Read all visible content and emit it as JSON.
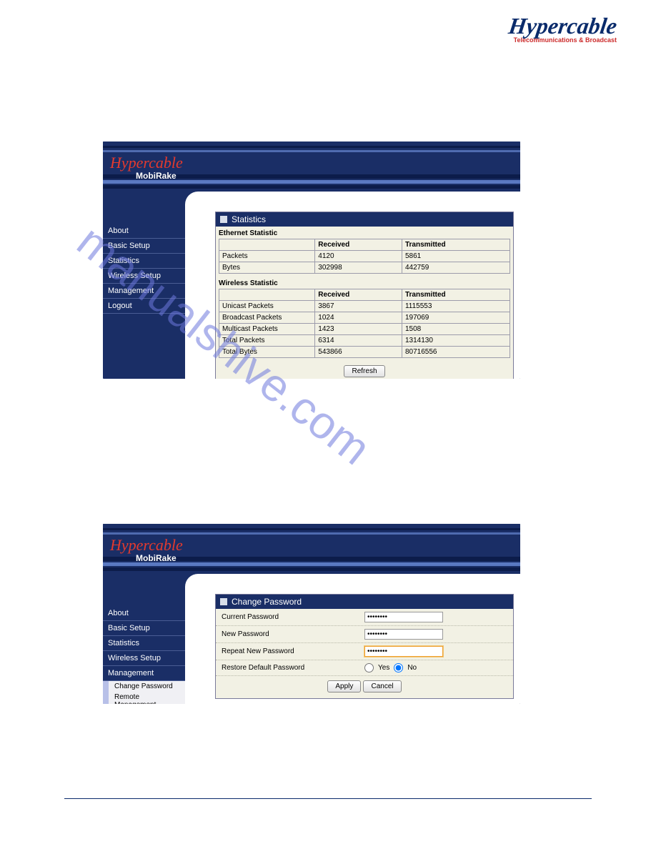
{
  "header_logo": {
    "main": "Hypercable",
    "tag": "Telecommunications & Broadcast"
  },
  "shot1": {
    "banner_logo": {
      "script": "Hypercable",
      "sub": "MobiRake"
    },
    "nav": [
      "About",
      "Basic Setup",
      "Statistics",
      "Wireless Setup",
      "Management",
      "Logout"
    ],
    "panel_title": "Statistics",
    "ethernet": {
      "label": "Ethernet Statistic",
      "cols": [
        "",
        "Received",
        "Transmitted"
      ],
      "rows": [
        [
          "Packets",
          "4120",
          "5861"
        ],
        [
          "Bytes",
          "302998",
          "442759"
        ]
      ]
    },
    "wireless": {
      "label": "Wireless Statistic",
      "cols": [
        "",
        "Received",
        "Transmitted"
      ],
      "rows": [
        [
          "Unicast Packets",
          "3867",
          "1115553"
        ],
        [
          "Broadcast Packets",
          "1024",
          "197069"
        ],
        [
          "Multicast Packets",
          "1423",
          "1508"
        ],
        [
          "Total Packets",
          "6314",
          "1314130"
        ],
        [
          "Total Bytes",
          "543866",
          "80716556"
        ]
      ]
    },
    "refresh": "Refresh"
  },
  "shot2": {
    "banner_logo": {
      "script": "Hypercable",
      "sub": "MobiRake"
    },
    "nav": [
      "About",
      "Basic Setup",
      "Statistics",
      "Wireless Setup",
      "Management"
    ],
    "subnav": [
      "Change Password",
      "Remote Management"
    ],
    "panel_title": "Change Password",
    "fields": {
      "current": {
        "label": "Current Password",
        "value": "••••••••"
      },
      "newp": {
        "label": "New Password",
        "value": "••••••••"
      },
      "repeat": {
        "label": "Repeat New Password",
        "value": "••••••••"
      },
      "restore": {
        "label": "Restore Default Password",
        "yes": "Yes",
        "no": "No"
      }
    },
    "apply": "Apply",
    "cancel": "Cancel"
  },
  "watermark": "manualshive.com"
}
